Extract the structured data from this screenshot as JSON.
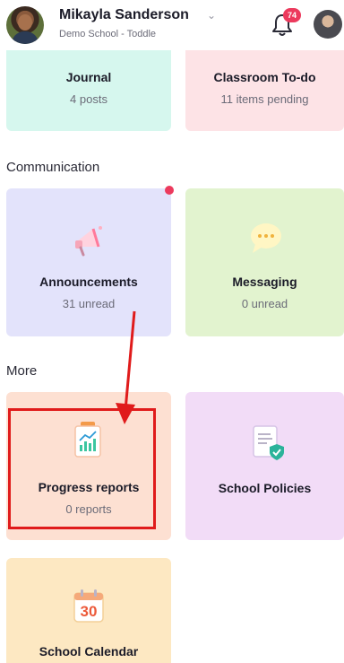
{
  "header": {
    "user_name": "Mikayla Sanderson",
    "school": "Demo School - Toddle",
    "notification_count": "74"
  },
  "top_cards": [
    {
      "title": "Journal",
      "subtitle": "4 posts",
      "color": "#d6f7ee"
    },
    {
      "title": "Classroom To-do",
      "subtitle": "11 items pending",
      "color": "#fde3e6"
    }
  ],
  "sections": {
    "communication": "Communication",
    "more": "More"
  },
  "communication_cards": [
    {
      "title": "Announcements",
      "subtitle": "31 unread",
      "color": "#e3e3fb",
      "icon": "megaphone-icon"
    },
    {
      "title": "Messaging",
      "subtitle": "0 unread",
      "color": "#e2f3cf",
      "icon": "chat-bubble-icon"
    }
  ],
  "more_cards": [
    {
      "title": "Progress reports",
      "subtitle": "0 reports",
      "color": "#fde0d2",
      "icon": "progress-report-icon"
    },
    {
      "title": "School Policies",
      "subtitle": "",
      "color": "#f2dcf7",
      "icon": "policy-document-icon"
    },
    {
      "title": "School Calendar",
      "subtitle": "",
      "color": "#fde8c2",
      "icon": "calendar-icon",
      "calendar_day": "30"
    }
  ],
  "colors": {
    "accent_red": "#e01b1b",
    "badge": "#ec3a5d"
  }
}
